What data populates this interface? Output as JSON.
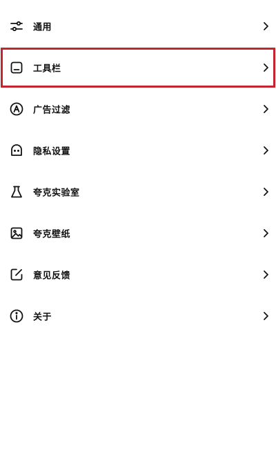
{
  "settings": {
    "items": [
      {
        "label": "通用",
        "icon": "sliders-icon",
        "highlighted": false
      },
      {
        "label": "工具栏",
        "icon": "toolbar-icon",
        "highlighted": true
      },
      {
        "label": "广告过滤",
        "icon": "ad-filter-icon",
        "highlighted": false
      },
      {
        "label": "隐私设置",
        "icon": "privacy-icon",
        "highlighted": false
      },
      {
        "label": "夸克实验室",
        "icon": "flask-icon",
        "highlighted": false
      },
      {
        "label": "夸克壁纸",
        "icon": "wallpaper-icon",
        "highlighted": false
      },
      {
        "label": "意见反馈",
        "icon": "feedback-icon",
        "highlighted": false
      },
      {
        "label": "关于",
        "icon": "info-icon",
        "highlighted": false
      }
    ]
  },
  "colors": {
    "highlight_border": "#c4242d",
    "text": "#111111",
    "background": "#ffffff"
  }
}
